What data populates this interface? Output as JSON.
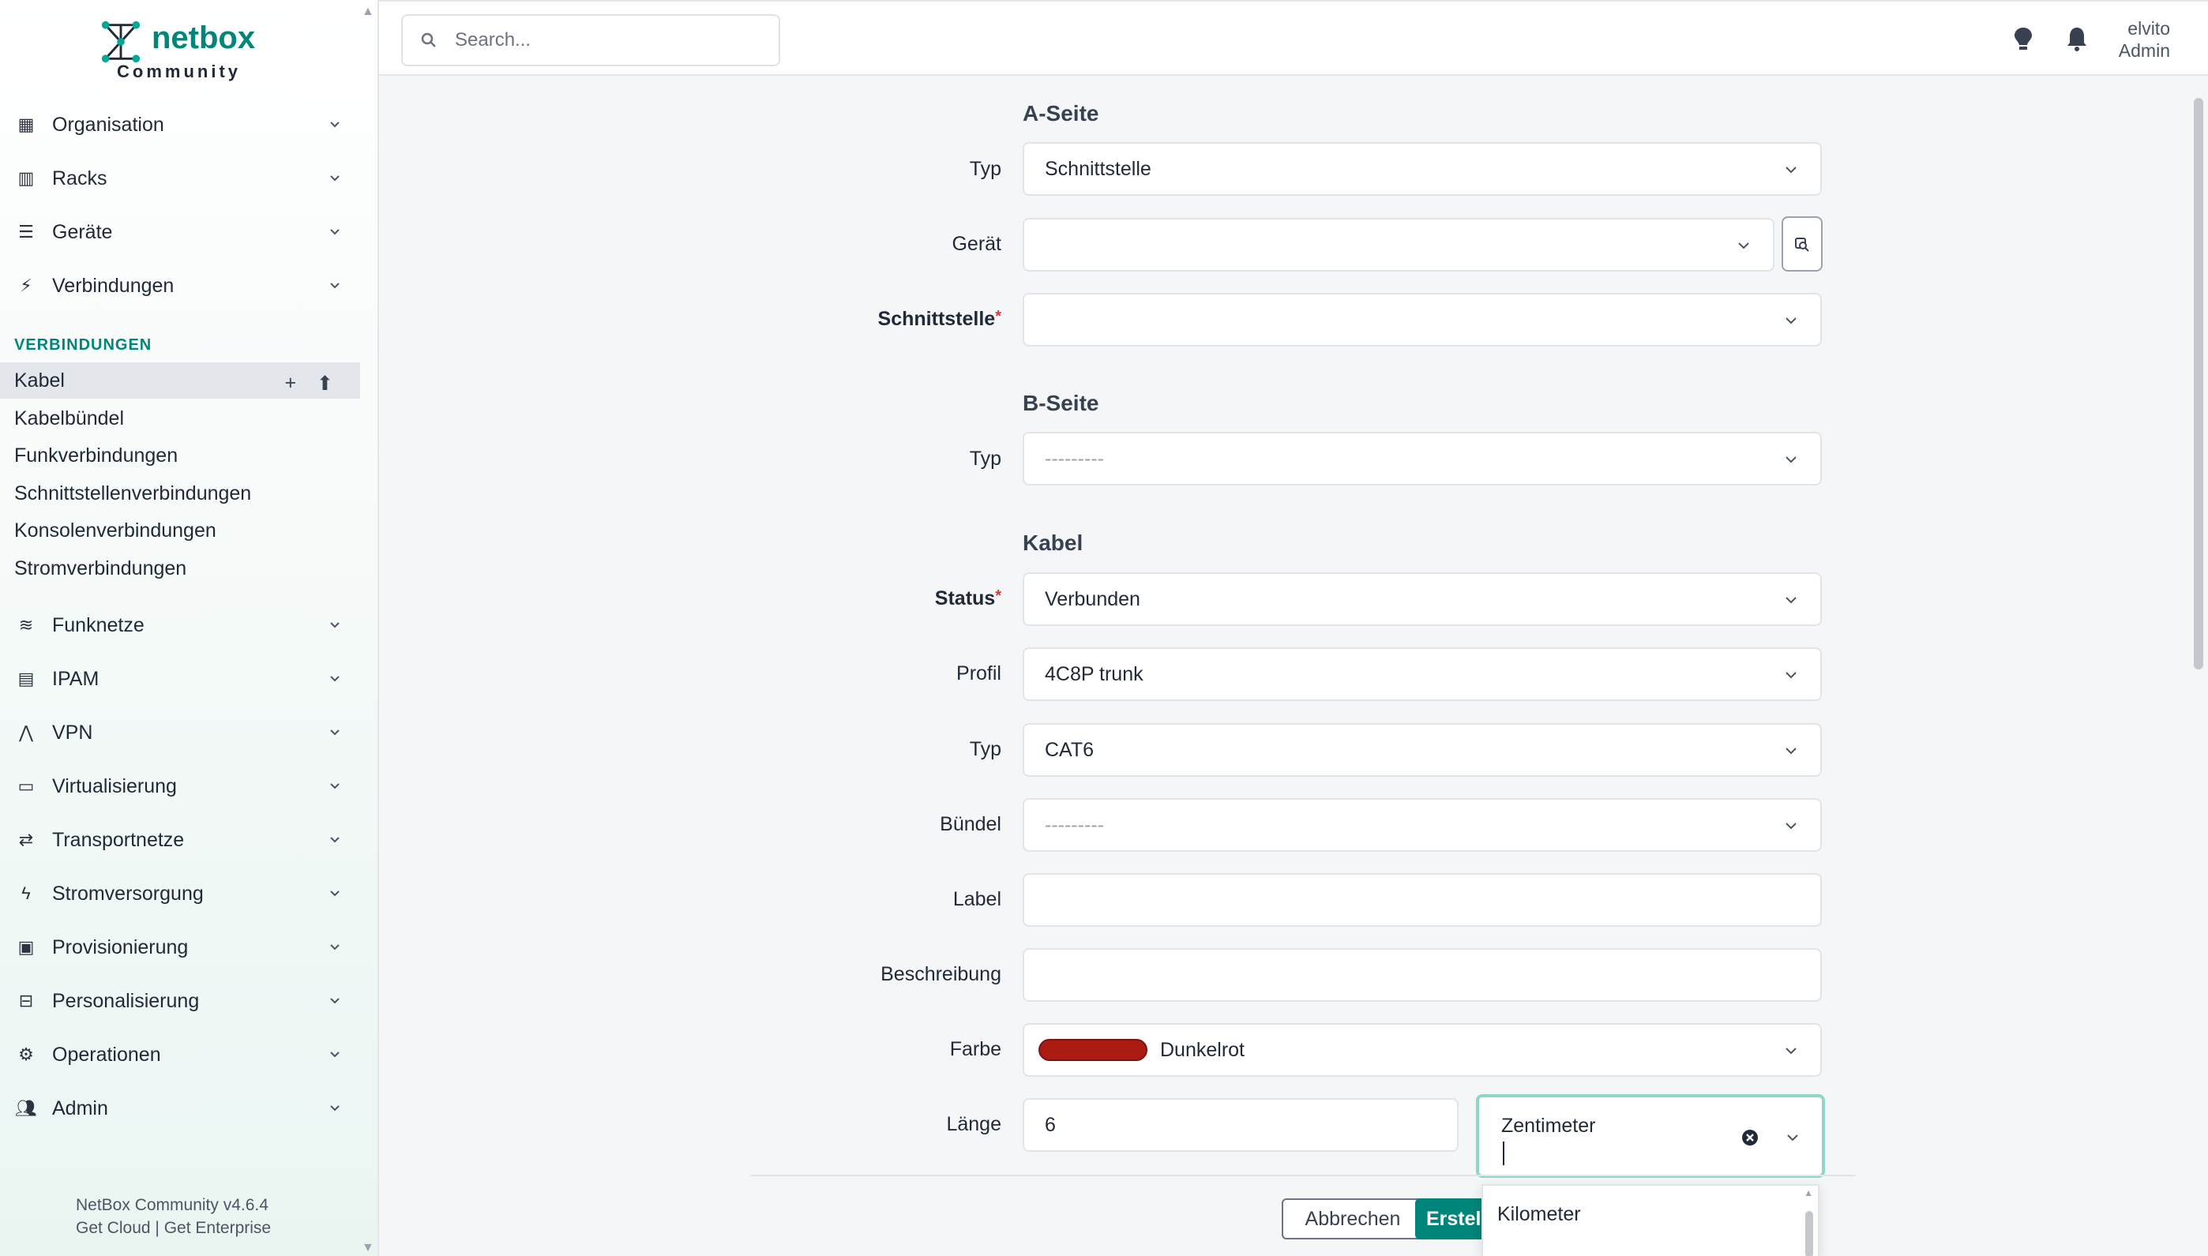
{
  "brand": {
    "name": "netbox",
    "sub": "Community"
  },
  "search": {
    "placeholder": "Search..."
  },
  "user": {
    "name": "elvito",
    "role": "Admin"
  },
  "sidebar": {
    "groups_top": [
      {
        "label": "Organisation",
        "icon": "building-icon"
      },
      {
        "label": "Racks",
        "icon": "rack-icon"
      },
      {
        "label": "Geräte",
        "icon": "server-icon"
      },
      {
        "label": "Verbindungen",
        "icon": "connection-icon"
      }
    ],
    "section_label": "VERBINDUNGEN",
    "sub_items": [
      "Kabel",
      "Kabelbündel",
      "Funkverbindungen",
      "Schnittstellenverbindungen",
      "Konsolenverbindungen",
      "Stromverbindungen"
    ],
    "groups_bottom": [
      {
        "label": "Funknetze",
        "icon": "wifi-icon"
      },
      {
        "label": "IPAM",
        "icon": "counter-icon"
      },
      {
        "label": "VPN",
        "icon": "tunnel-icon"
      },
      {
        "label": "Virtualisierung",
        "icon": "monitor-icon"
      },
      {
        "label": "Transportnetze",
        "icon": "transport-icon"
      },
      {
        "label": "Stromversorgung",
        "icon": "flash-icon"
      },
      {
        "label": "Provisionierung",
        "icon": "file-icon"
      },
      {
        "label": "Personalisierung",
        "icon": "toolbox-icon"
      },
      {
        "label": "Operationen",
        "icon": "cogs-icon"
      },
      {
        "label": "Admin",
        "icon": "users-icon"
      }
    ],
    "footer": {
      "version": "NetBox Community v4.6.4",
      "link1": "Get Cloud",
      "sep": "|",
      "link2": "Get Enterprise"
    }
  },
  "form": {
    "a_side": {
      "title": "A-Seite",
      "type_label": "Typ",
      "type_value": "Schnittstelle",
      "device_label": "Gerät",
      "device_value": "",
      "interface_label": "Schnittstelle",
      "interface_value": ""
    },
    "b_side": {
      "title": "B-Seite",
      "type_label": "Typ",
      "type_value": "---------"
    },
    "cable": {
      "title": "Kabel",
      "status_label": "Status",
      "status_value": "Verbunden",
      "profile_label": "Profil",
      "profile_value": "4C8P trunk",
      "type_label": "Typ",
      "type_value": "CAT6",
      "bundle_label": "Bündel",
      "bundle_value": "---------",
      "label_label": "Label",
      "label_value": "",
      "description_label": "Beschreibung",
      "description_value": "",
      "color_label": "Farbe",
      "color_value": "Dunkelrot",
      "color_hex": "#aa1c13",
      "length_label": "Länge",
      "length_value": "6",
      "unit_value": "Zentimeter",
      "unit_options": [
        "Kilometer"
      ]
    },
    "buttons": {
      "cancel": "Abbrechen",
      "create": "Erstell"
    }
  },
  "colors": {
    "accent": "#00857a",
    "required": "#d9363e"
  }
}
